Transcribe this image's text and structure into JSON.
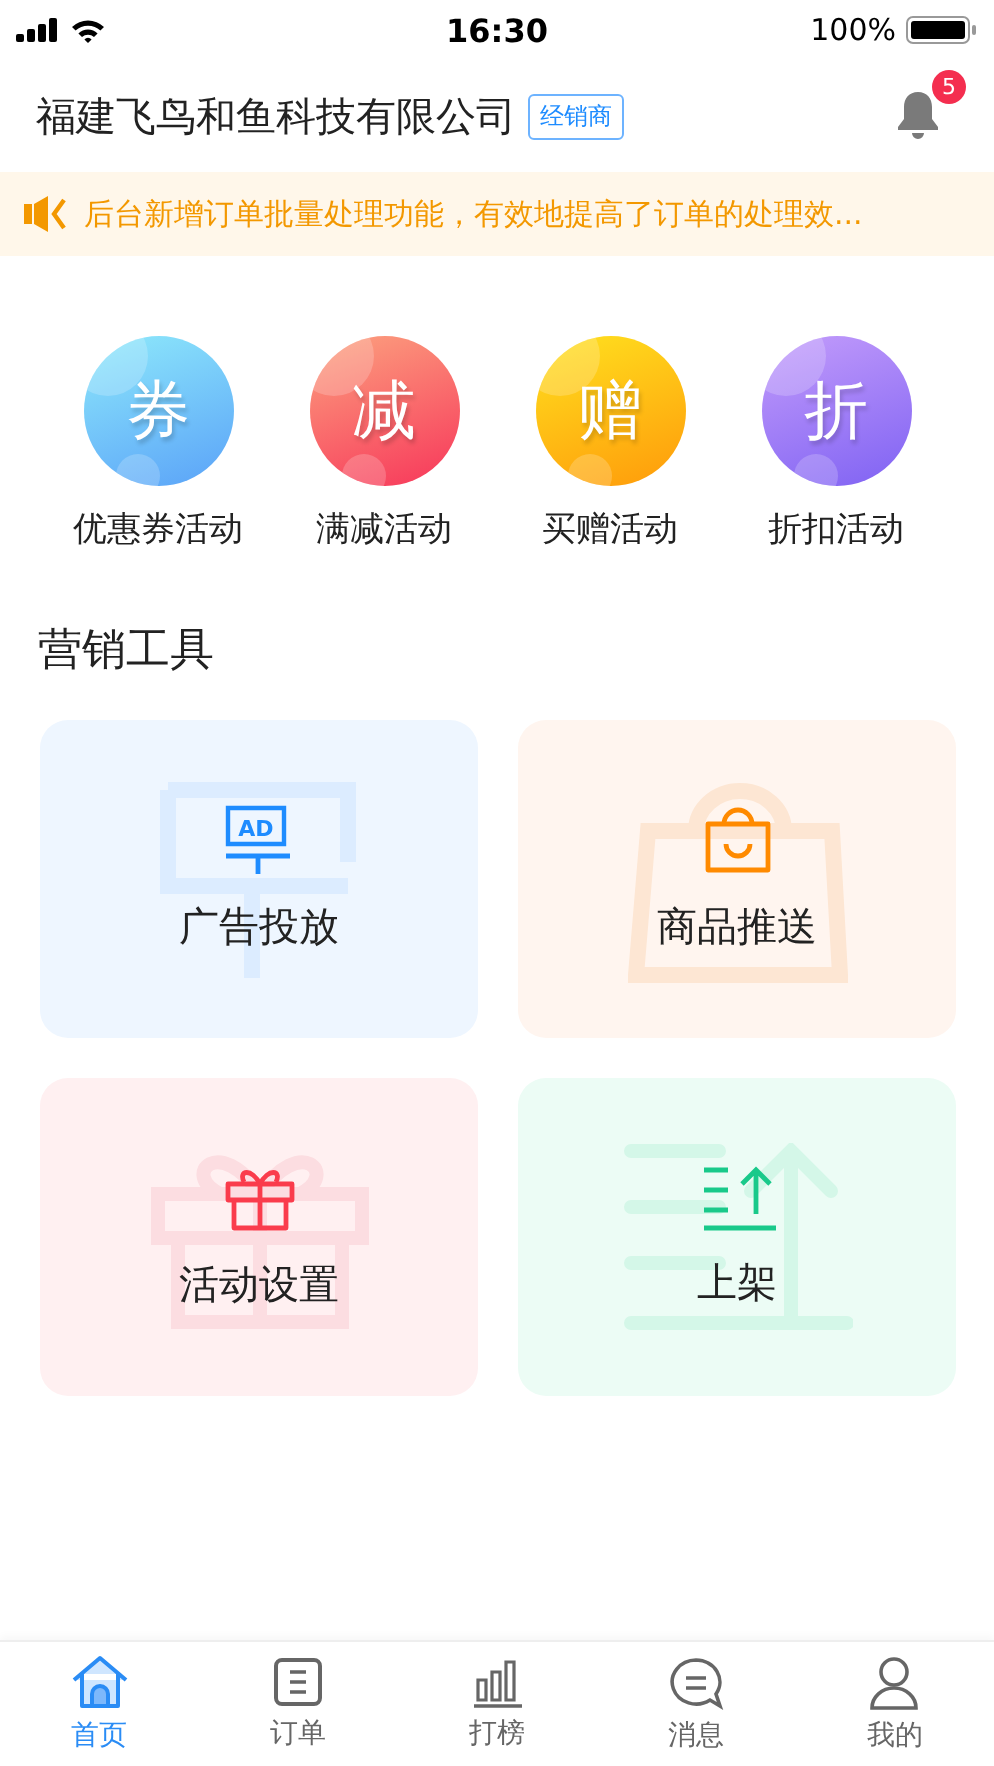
{
  "status_bar": {
    "time": "16:30",
    "battery": "100%"
  },
  "header": {
    "title": "福建飞鸟和鱼科技有限公司",
    "tag": "经销商",
    "notification_count": "5"
  },
  "notice": {
    "text": "后台新增订单批量处理功能，有效地提高了订单的处理效..."
  },
  "activities": [
    {
      "kind": "coupon",
      "glyph": "券",
      "label": "优惠券活动"
    },
    {
      "kind": "reduce",
      "glyph": "减",
      "label": "满减活动"
    },
    {
      "kind": "gift",
      "glyph": "赠",
      "label": "买赠活动"
    },
    {
      "kind": "discount",
      "glyph": "折",
      "label": "折扣活动"
    }
  ],
  "section_title": "营销工具",
  "tools": [
    {
      "kind": "ad",
      "label": "广告投放",
      "icon_text": "AD"
    },
    {
      "kind": "push",
      "label": "商品推送"
    },
    {
      "kind": "event",
      "label": "活动设置"
    },
    {
      "kind": "shelf",
      "label": "上架"
    }
  ],
  "tab_bar": [
    {
      "kind": "home",
      "label": "首页",
      "selected": true
    },
    {
      "kind": "orders",
      "label": "订单",
      "selected": false
    },
    {
      "kind": "rank",
      "label": "打榜",
      "selected": false
    },
    {
      "kind": "messages",
      "label": "消息",
      "selected": false
    },
    {
      "kind": "profile",
      "label": "我的",
      "selected": false
    }
  ]
}
